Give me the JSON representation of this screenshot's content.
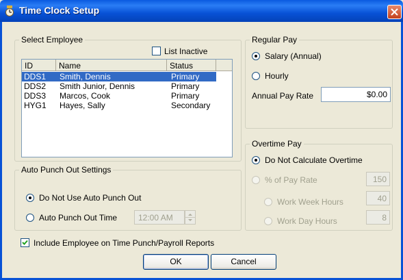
{
  "window": {
    "title": "Time Clock Setup"
  },
  "select_employee": {
    "legend": "Select Employee",
    "list_inactive_label": "List Inactive",
    "columns": [
      "ID",
      "Name",
      "Status"
    ],
    "rows": [
      {
        "id": "DDS1",
        "name": "Smith, Dennis",
        "status": "Primary"
      },
      {
        "id": "DDS2",
        "name": "Smith Junior, Dennis",
        "status": "Primary"
      },
      {
        "id": "DDS3",
        "name": "Marcos, Cook",
        "status": "Primary"
      },
      {
        "id": "HYG1",
        "name": "Hayes, Sally",
        "status": "Secondary"
      }
    ]
  },
  "auto_punch": {
    "legend": "Auto Punch Out Settings",
    "option_none": "Do Not Use Auto Punch Out",
    "option_time": "Auto Punch Out Time",
    "time_value": "12:00 AM"
  },
  "regular_pay": {
    "legend": "Regular Pay",
    "option_salary": "Salary (Annual)",
    "option_hourly": "Hourly",
    "rate_label": "Annual Pay Rate",
    "rate_value": "$0.00"
  },
  "overtime_pay": {
    "legend": "Overtime Pay",
    "option_none": "Do Not Calculate Overtime",
    "option_percent": "% of Pay Rate",
    "percent_value": "150",
    "week_label": "Work Week Hours",
    "week_value": "40",
    "day_label": "Work Day Hours",
    "day_value": "8"
  },
  "include_reports_label": "Include Employee on Time Punch/Payroll Reports",
  "buttons": {
    "ok": "OK",
    "cancel": "Cancel"
  }
}
